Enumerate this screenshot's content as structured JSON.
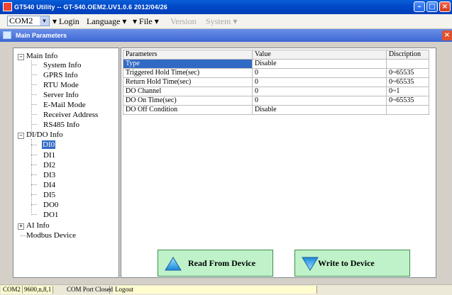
{
  "titlebar": {
    "title": "GT540 Utility -- GT-540.OEM2.UV1.0.6 2012/04/26"
  },
  "menubar": {
    "port": "COM2",
    "items": [
      {
        "label": "Login",
        "enabled": true
      },
      {
        "label": "Language",
        "enabled": true,
        "has_dropdown": true
      },
      {
        "label": "File",
        "enabled": true,
        "has_dropdown": true
      },
      {
        "label": "Version",
        "enabled": false
      },
      {
        "label": "System",
        "enabled": false,
        "has_dropdown": true
      }
    ]
  },
  "subwindow": {
    "title": "Main Parameters"
  },
  "tree": {
    "main_info": "Main Info",
    "system_info": "System Info",
    "gprs_info": "GPRS Info",
    "rtu_mode": "RTU Mode",
    "server_info": "Server Info",
    "email_mode": "E-Mail Mode",
    "receiver_address": "Receiver Address",
    "rs485_info": "RS485 Info",
    "dido_info": "DI/DO Info",
    "di0": "DI0",
    "di1": "DI1",
    "di2": "DI2",
    "di3": "DI3",
    "di4": "DI4",
    "di5": "DI5",
    "do0": "DO0",
    "do1": "DO1",
    "ai_info": "AI Info",
    "modbus_device": "Modbus Device",
    "selected": "DI0"
  },
  "grid": {
    "headers": {
      "parameters": "Parameters",
      "value": "Value",
      "description": "Discription"
    },
    "rows": [
      {
        "param": "Type",
        "value": "Disable",
        "desc": ""
      },
      {
        "param": "Triggered Hold Time(sec)",
        "value": "0",
        "desc": "0~65535"
      },
      {
        "param": "Return Hold Time(sec)",
        "value": "0",
        "desc": "0~65535"
      },
      {
        "param": "DO Channel",
        "value": "0",
        "desc": "0~1"
      },
      {
        "param": "DO On Time(sec)",
        "value": "0",
        "desc": "0~65535"
      },
      {
        "param": "DO Off Condition",
        "value": "Disable",
        "desc": ""
      }
    ]
  },
  "buttons": {
    "read": "Read From Device",
    "write": "Write to Device"
  },
  "status": {
    "port": "COM2",
    "settings": "9600,n,8,1",
    "state": "COM Port Closed",
    "user": "Logout"
  },
  "colors": {
    "title_bar": "#0048c8",
    "selection": "#316ac5",
    "button_bg": "#bff2c8"
  }
}
